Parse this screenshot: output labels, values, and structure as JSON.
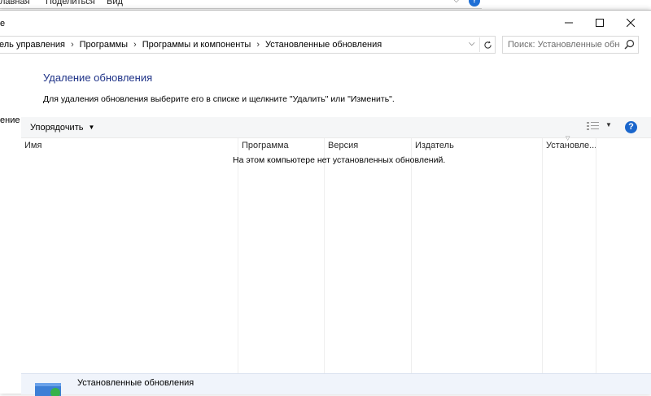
{
  "background_window": {
    "ribbon_tabs": [
      "лавная",
      "Поделиться",
      "Вид"
    ],
    "side_text_1": "е",
    "side_text_2": "ение"
  },
  "window": {
    "controls": {
      "minimize": "minimize",
      "maximize": "maximize",
      "close": "close"
    }
  },
  "address": {
    "breadcrumbs": [
      "ель управления",
      "Программы",
      "Программы и компоненты",
      "Установленные обновления"
    ],
    "separator": "›"
  },
  "search": {
    "placeholder": "Поиск: Установленные обно..."
  },
  "content": {
    "heading": "Удаление обновления",
    "instructions": "Для удаления обновления выберите его в списке и щелкните \"Удалить\" или \"Изменить\"."
  },
  "toolbar": {
    "organize_label": "Упорядочить"
  },
  "list": {
    "columns": [
      "Имя",
      "Программа",
      "Версия",
      "Издатель",
      "Установле..."
    ],
    "empty_message": "На этом компьютере нет установленных обновлений."
  },
  "details": {
    "title": "Установленные обновления"
  },
  "colors": {
    "heading": "#1e3287",
    "help": "#1a66cc",
    "details_bg": "#f0f4fb"
  }
}
